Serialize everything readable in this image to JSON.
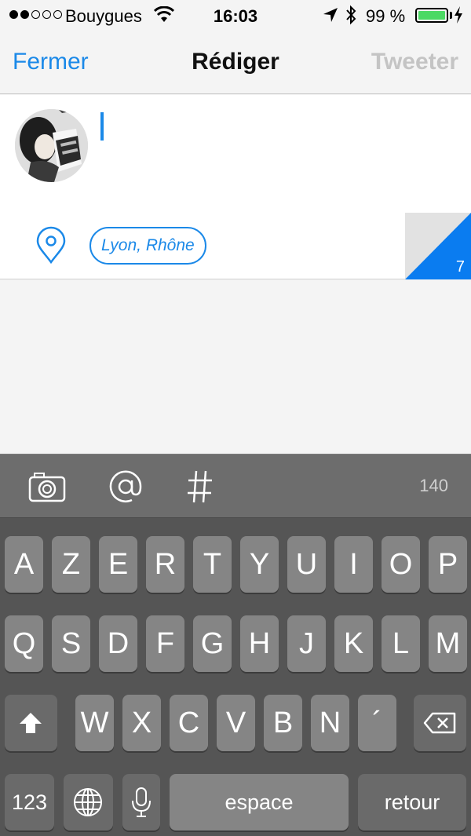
{
  "status_bar": {
    "carrier": "Bouygues",
    "time": "16:03",
    "battery": "99 %",
    "battery_level": 0.99
  },
  "nav": {
    "left": "Fermer",
    "title": "Rédiger",
    "right": "Tweeter"
  },
  "compose": {
    "location": "Lyon, Rhône",
    "media_count": "7"
  },
  "toolbar": {
    "counter": "140"
  },
  "keyboard": {
    "row1": [
      "A",
      "Z",
      "E",
      "R",
      "T",
      "Y",
      "U",
      "I",
      "O",
      "P"
    ],
    "row2": [
      "Q",
      "S",
      "D",
      "F",
      "G",
      "H",
      "J",
      "K",
      "L",
      "M"
    ],
    "row3": [
      "W",
      "X",
      "C",
      "V",
      "B",
      "N",
      "´"
    ],
    "numbers": "123",
    "space": "espace",
    "return": "retour"
  },
  "colors": {
    "accent": "#1b89e8",
    "battery": "#4cd964"
  }
}
